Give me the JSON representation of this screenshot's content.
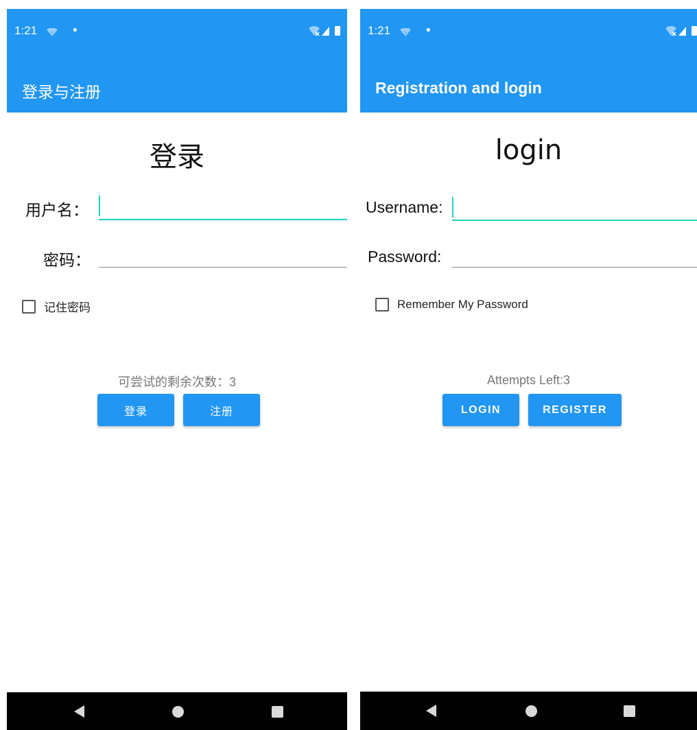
{
  "colors": {
    "primary": "#2196F3",
    "accent": "#1DD2C6",
    "navbar": "#000000",
    "hint_text": "#777777"
  },
  "screens": [
    {
      "status": {
        "time": "1:21",
        "icons": [
          "wifi-icon",
          "notification-dot",
          "signal-icon",
          "battery-icon"
        ]
      },
      "appbar": {
        "title": "登录与注册"
      },
      "heading": "登录",
      "username": {
        "label": "用户名：",
        "value": ""
      },
      "password": {
        "label": "密码：",
        "value": ""
      },
      "remember": {
        "label": "记住密码",
        "checked": false
      },
      "attempts_text": "可尝试的剩余次数：3",
      "buttons": {
        "login": "登录",
        "register": "注册"
      },
      "nav": [
        "back-icon",
        "home-icon",
        "recents-icon"
      ]
    },
    {
      "status": {
        "time": "1:21",
        "icons": [
          "wifi-icon",
          "notification-dot",
          "signal-icon",
          "battery-icon"
        ]
      },
      "appbar": {
        "title": "Registration and login"
      },
      "heading": "login",
      "username": {
        "label": "Username:",
        "value": ""
      },
      "password": {
        "label": "Password:",
        "value": ""
      },
      "remember": {
        "label": "Remember My Password",
        "checked": false
      },
      "attempts_text": "Attempts Left:3",
      "buttons": {
        "login": "LOGIN",
        "register": "REGISTER"
      },
      "nav": [
        "back-icon",
        "home-icon",
        "recents-icon"
      ]
    }
  ]
}
